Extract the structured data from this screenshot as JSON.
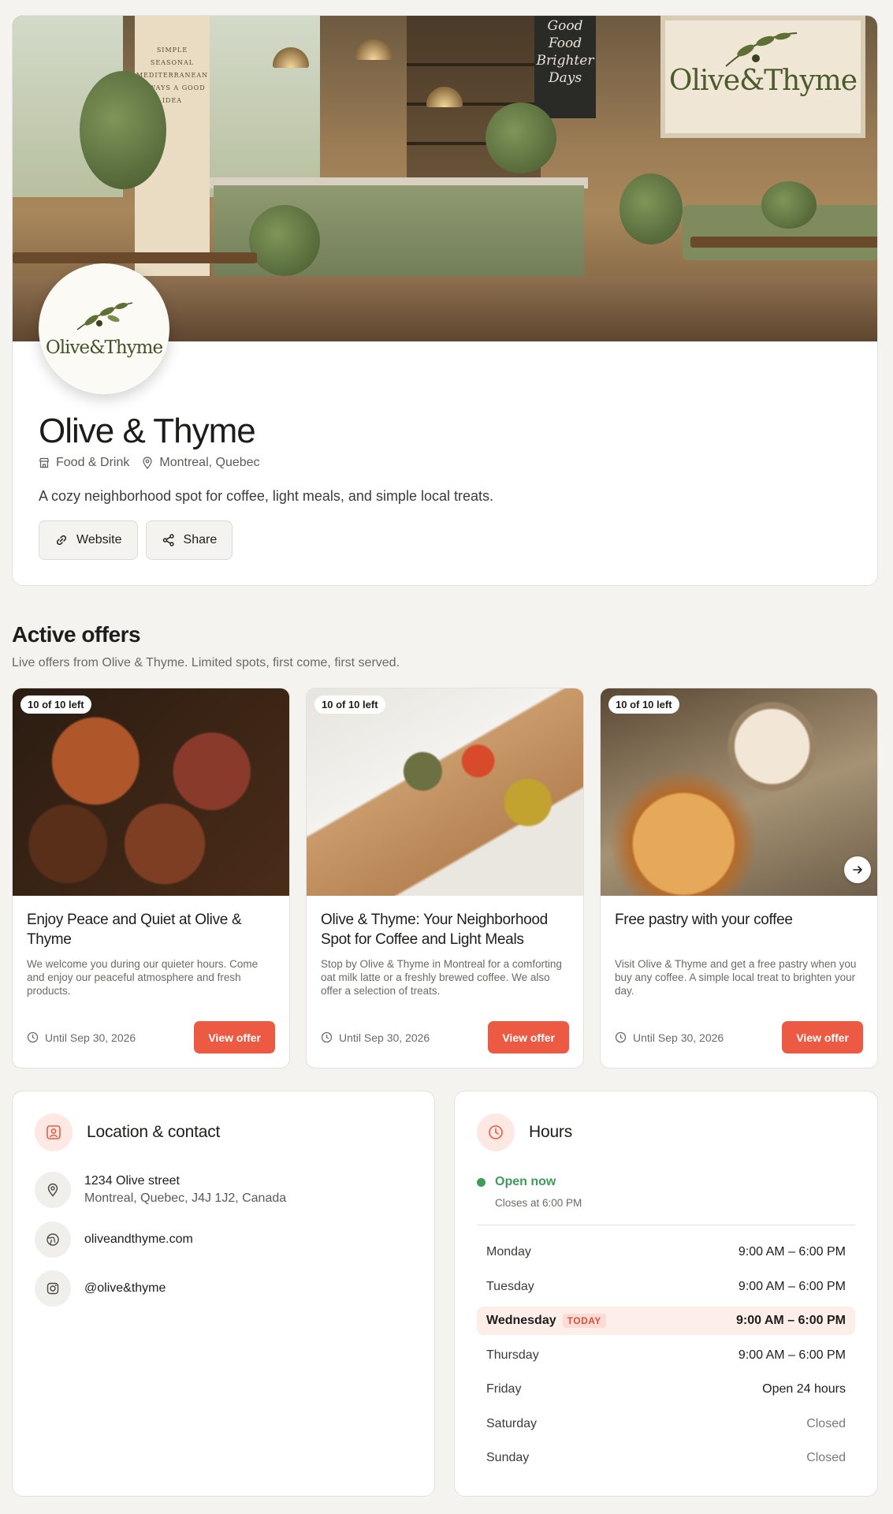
{
  "business": {
    "cover_logo_text": "Olive&Thyme",
    "cover_chalk_text": "Good Food Brighter Days",
    "cover_pillar_text": "SIMPLE SEASONAL MEDITERRANEAN ALWAYS A GOOD IDEA",
    "avatar_logo_text": "Olive&Thyme",
    "name": "Olive & Thyme",
    "category": "Food & Drink",
    "location": "Montreal, Quebec",
    "description": "A cozy neighborhood spot for coffee, light meals, and simple local treats.",
    "website_label": "Website",
    "share_label": "Share"
  },
  "offers_section": {
    "title": "Active offers",
    "subtitle": "Live offers from Olive & Thyme. Limited spots, first come, first served.",
    "offers": [
      {
        "badge": "10 of 10 left",
        "title": "Enjoy Peace and Quiet at Olive & Thyme",
        "description": "We welcome you during our quieter hours. Come and enjoy our peaceful atmosphere and fresh products.",
        "until": "Until Sep 30, 2026",
        "cta": "View offer"
      },
      {
        "badge": "10 of 10 left",
        "title": "Olive & Thyme: Your Neighborhood Spot for Coffee and Light Meals",
        "description": "Stop by Olive & Thyme in Montreal for a comforting oat milk latte or a freshly brewed coffee. We also offer a selection of treats.",
        "until": "Until Sep 30, 2026",
        "cta": "View offer"
      },
      {
        "badge": "10 of 10 left",
        "title": "Free pastry with your coffee",
        "description": "Visit Olive & Thyme and get a free pastry when you buy any coffee. A simple local treat to brighten your day.",
        "until": "Until Sep 30, 2026",
        "cta": "View offer"
      }
    ]
  },
  "location": {
    "title": "Location & contact",
    "street": "1234 Olive street",
    "city_line": "Montreal, Quebec, J4J 1J2, Canada",
    "website": "oliveandthyme.com",
    "instagram": "@olive&thyme"
  },
  "hours": {
    "title": "Hours",
    "status": "Open now",
    "closes": "Closes at 6:00 PM",
    "today_tag": "TODAY",
    "days": [
      {
        "day": "Monday",
        "time": "9:00 AM – 6:00 PM"
      },
      {
        "day": "Tuesday",
        "time": "9:00 AM – 6:00 PM"
      },
      {
        "day": "Wednesday",
        "time": "9:00 AM – 6:00 PM"
      },
      {
        "day": "Thursday",
        "time": "9:00 AM – 6:00 PM"
      },
      {
        "day": "Friday",
        "time": "Open 24 hours"
      },
      {
        "day": "Saturday",
        "time": "Closed"
      },
      {
        "day": "Sunday",
        "time": "Closed"
      }
    ]
  },
  "colors": {
    "accent": "#ec5a43",
    "open_green": "#3f9a5e",
    "page_bg": "#f4f3ef"
  }
}
